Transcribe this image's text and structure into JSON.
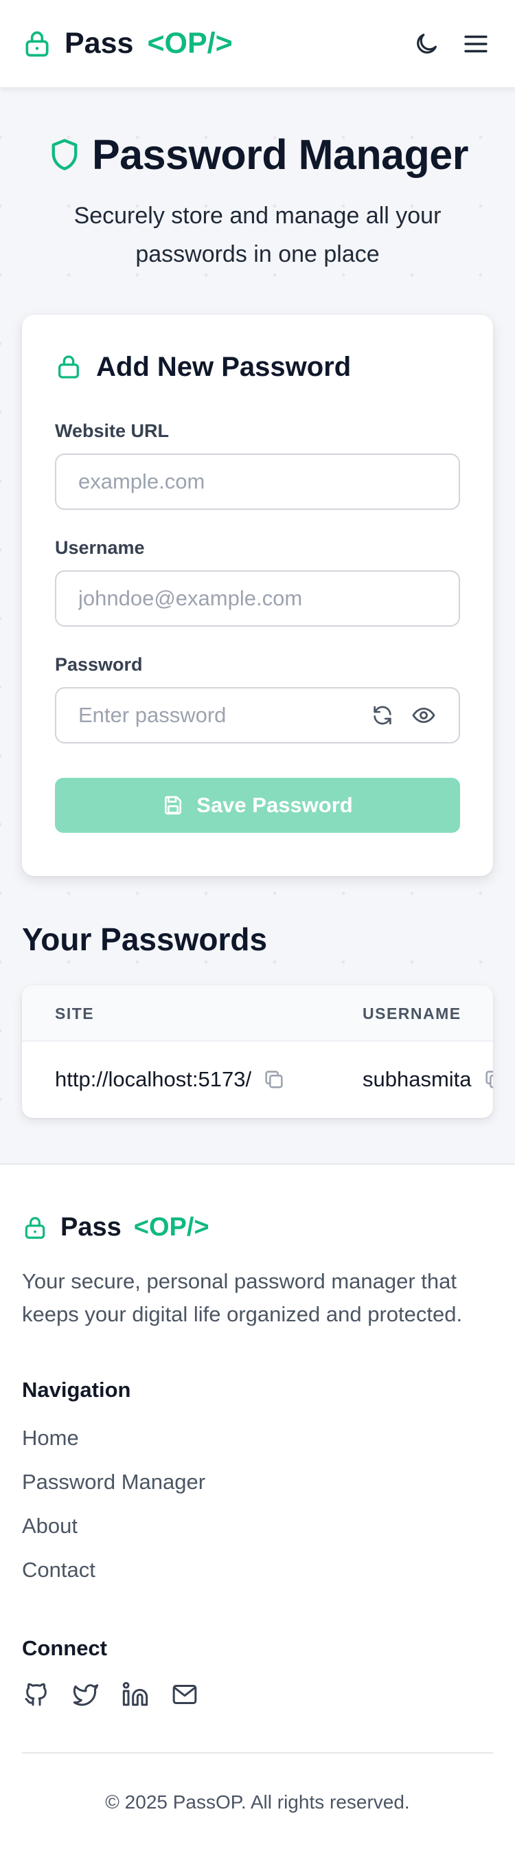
{
  "header": {
    "brand_main": "Pass",
    "brand_accent": "<OP/>",
    "icons": {
      "logo": "lock-icon",
      "theme_toggle": "moon-icon",
      "menu": "hamburger-menu-icon"
    }
  },
  "hero": {
    "title": "Password Manager",
    "subtitle": "Securely store and manage all your passwords in one place",
    "icon": "shield-icon"
  },
  "form": {
    "title": "Add New Password",
    "website_label": "Website URL",
    "website_placeholder": "example.com",
    "website_value": "",
    "username_label": "Username",
    "username_placeholder": "johndoe@example.com",
    "username_value": "",
    "password_label": "Password",
    "password_placeholder": "Enter password",
    "password_value": "",
    "password_icons": [
      "refresh-icon",
      "eye-icon"
    ],
    "save_label": "Save Password"
  },
  "saved": {
    "title": "Your Passwords",
    "columns": [
      "SITE",
      "USERNAME"
    ],
    "rows": [
      {
        "site": "http://localhost:5173/",
        "username": "subhasmita"
      }
    ]
  },
  "footer": {
    "brand_main": "Pass",
    "brand_accent": "<OP/>",
    "description": "Your secure, personal password manager that keeps your digital life organized and protected.",
    "nav_heading": "Navigation",
    "nav_links": [
      "Home",
      "Password Manager",
      "About",
      "Contact"
    ],
    "connect_heading": "Connect",
    "social_icons": [
      "github-icon",
      "twitter-icon",
      "linkedin-icon",
      "mail-icon"
    ],
    "copyright": "© 2025 PassOP. All rights reserved."
  },
  "colors": {
    "accent": "#10b981",
    "save_button_disabled": "#86dcbd",
    "page_background": "#f5f6f9",
    "heading_text": "#0f172a",
    "muted_text": "#4b5563"
  }
}
